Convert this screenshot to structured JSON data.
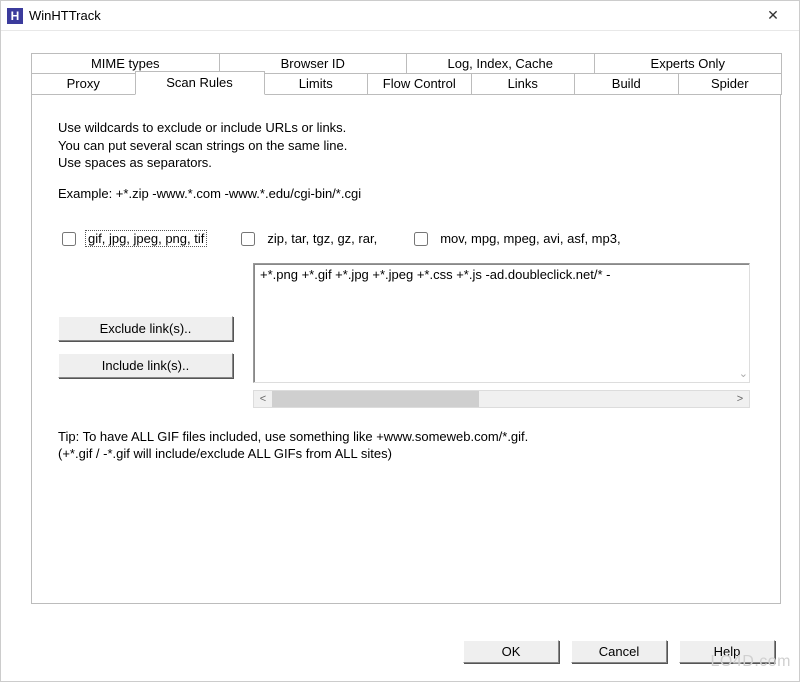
{
  "window": {
    "title": "WinHTTrack",
    "icon_letter": "H"
  },
  "tabs": {
    "row1": [
      "MIME types",
      "Browser ID",
      "Log, Index, Cache",
      "Experts Only"
    ],
    "row2": [
      "Proxy",
      "Scan Rules",
      "Limits",
      "Flow Control",
      "Links",
      "Build",
      "Spider"
    ],
    "active": "Scan Rules"
  },
  "instructions": {
    "line1": "Use wildcards to exclude or include URLs or links.",
    "line2": "You can put several scan strings on the same line.",
    "line3": "Use spaces as separators.",
    "example": "Example: +*.zip -www.*.com -www.*.edu/cgi-bin/*.cgi"
  },
  "checkboxes": [
    {
      "label": "gif, jpg, jpeg, png, tif",
      "focused": true
    },
    {
      "label": "zip, tar, tgz, gz, rar,",
      "focused": false
    },
    {
      "label": "mov, mpg, mpeg, avi, asf, mp3,",
      "focused": false
    }
  ],
  "rules_text": "+*.png +*.gif +*.jpg +*.jpeg +*.css +*.js -ad.doubleclick.net/* -",
  "buttons": {
    "exclude": "Exclude link(s)..",
    "include": "Include link(s).."
  },
  "tip": {
    "line1": "Tip: To have ALL GIF files included, use something like +www.someweb.com/*.gif.",
    "line2": "(+*.gif / -*.gif will include/exclude ALL GIFs from ALL sites)"
  },
  "dialog": {
    "ok": "OK",
    "cancel": "Cancel",
    "help": "Help"
  },
  "watermark": "LO4D.com"
}
